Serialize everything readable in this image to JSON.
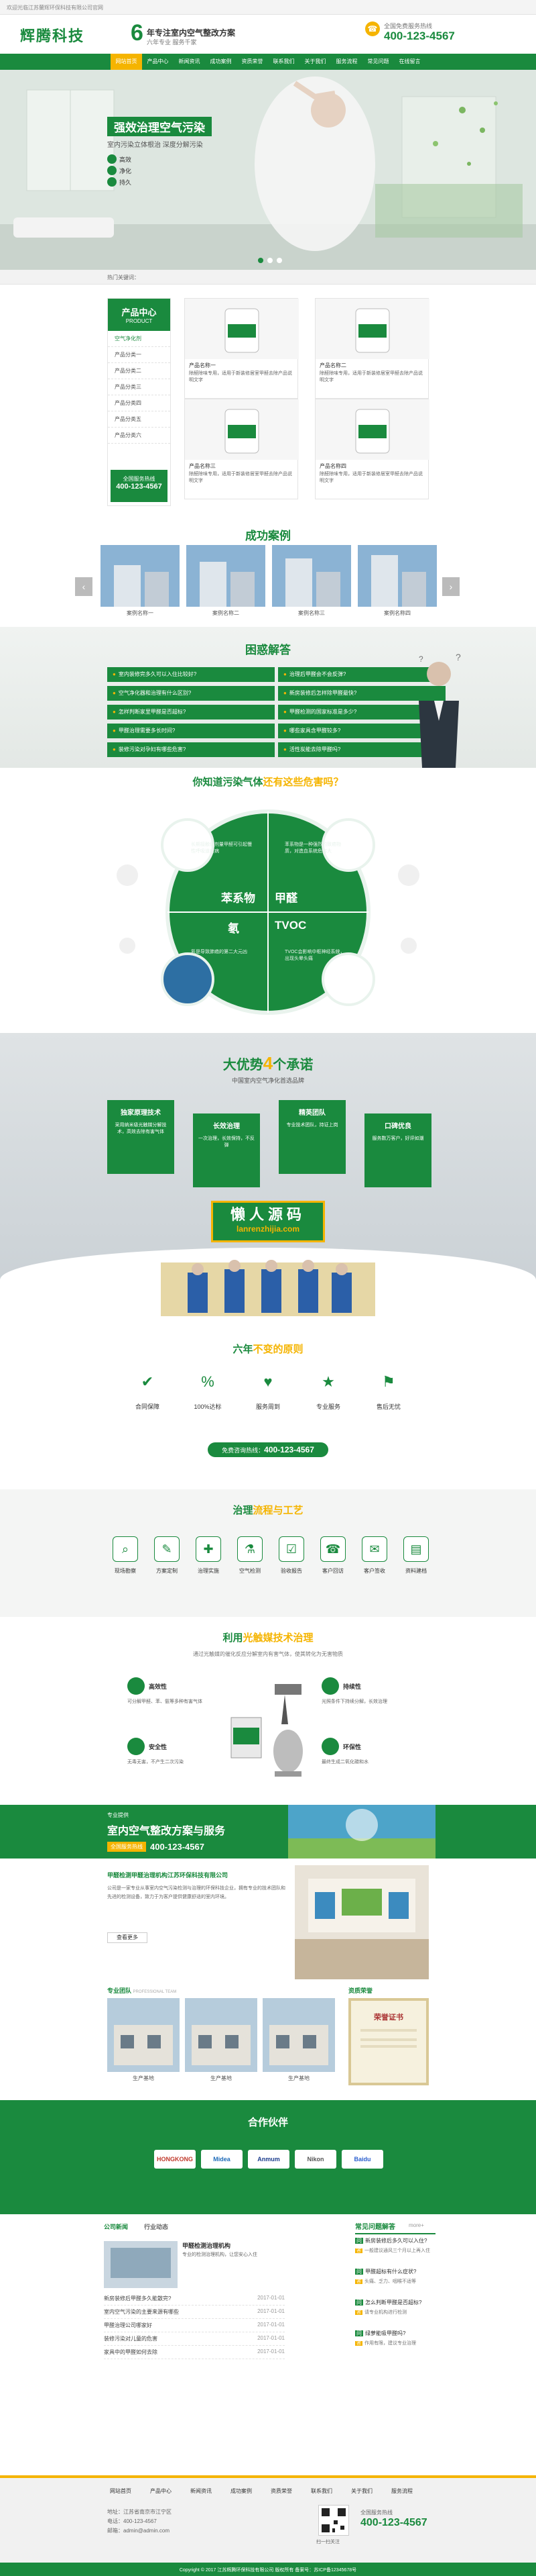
{
  "topbar": {
    "text": "欢迎光临江苏蘭辉环保科技有限公司官网"
  },
  "header": {
    "logo": "辉腾科技",
    "slogan_num": "6",
    "slogan_title": "年专注室内空气整改方案",
    "slogan_sub": "六年专业 服务千家",
    "hotline_label": "全国免费服务热线",
    "hotline": "400-123-4567"
  },
  "nav": [
    "网站首页",
    "产品中心",
    "新闻资讯",
    "成功案例",
    "资质荣誉",
    "联系我们",
    "关于我们",
    "服务流程",
    "常见问题",
    "在线留言"
  ],
  "nav_active": 0,
  "hero": {
    "title": "强效治理空气污染",
    "subtitle": "室内污染立体根治 深度分解污染",
    "features": [
      "高效",
      "净化",
      "持久"
    ],
    "dots": 3
  },
  "breadcrumb": "热门关键词：",
  "products": {
    "title": "产品中心",
    "title_en": "PRODUCT",
    "categories": [
      "空气净化剂",
      "产品分类一",
      "产品分类二",
      "产品分类三",
      "产品分类四",
      "产品分类五",
      "产品分类六"
    ],
    "hotline_label": "全国服务热线",
    "hotline": "400-123-4567",
    "items": [
      {
        "name": "产品名称一",
        "desc": "除醛除味专用，适用于新装修居室甲醛去除产品说明文字"
      },
      {
        "name": "产品名称二",
        "desc": "除醛除味专用，适用于新装修居室甲醛去除产品说明文字"
      },
      {
        "name": "产品名称三",
        "desc": "除醛除味专用，适用于新装修居室甲醛去除产品说明文字"
      },
      {
        "name": "产品名称四",
        "desc": "除醛除味专用，适用于新装修居室甲醛去除产品说明文字"
      }
    ]
  },
  "cases": {
    "title": "成功案例",
    "items": [
      "案例名称一",
      "案例名称二",
      "案例名称三",
      "案例名称四"
    ]
  },
  "faq": {
    "title": "困惑解答",
    "left": [
      "室内装修完多久可以入住比较好?",
      "空气净化器和治理有什么区别?",
      "怎样判断家里甲醛是否超标?",
      "甲醛治理需要多长时间?",
      "装修污染对孕妇有哪些危害?"
    ],
    "right": [
      "治理后甲醛会不会反弹?",
      "新房装修后怎样除甲醛最快?",
      "甲醛检测的国家标准是多少?",
      "哪些家具含甲醛较多?",
      "活性炭能去除甲醛吗?"
    ]
  },
  "pollution": {
    "title_a": "你知道污染气体",
    "title_b": "还有这些危害吗？",
    "center_words": [
      "苯系物",
      "甲醛",
      "氡",
      "TVOC"
    ],
    "texts": [
      "长期接触低剂量甲醛可引起慢性呼吸道疾病",
      "苯系物是一种强烈的致癌物质，对造血系统危害大",
      "氡是导致肺癌的第二大元凶",
      "TVOC会影响中枢神经系统，出现头晕头痛"
    ]
  },
  "advantage": {
    "title_a": "大优势",
    "num": "4",
    "title_b": "个承诺",
    "sub": "中国室内空气净化首选品牌",
    "boxes": [
      {
        "title": "独家原理技术",
        "text": "采用纳米级光触媒分解技术，高效去除有害气体"
      },
      {
        "title": "长效治理",
        "text": "一次治理，长效保持，不反弹"
      },
      {
        "title": "精英团队",
        "text": "专业技术团队，持证上岗"
      },
      {
        "title": "口碑优良",
        "text": "服务数万客户，好评如潮"
      }
    ],
    "watermark_cn": "懒人源码",
    "watermark_en": "lanrenzhijia.com"
  },
  "principle": {
    "title_a": "六年",
    "title_b": "不变的原则",
    "items": [
      "合同保障",
      "100%达标",
      "服务周到",
      "专业服务",
      "售后无忧"
    ],
    "btn_label": "免费咨询热线：",
    "hotline": "400-123-4567"
  },
  "process": {
    "title_a": "治理",
    "title_b": "流程与工艺",
    "steps": [
      "现场勘察",
      "方案定制",
      "治理实施",
      "空气检测",
      "验收报告",
      "客户回访",
      "客户签收",
      "资料建档"
    ]
  },
  "tech": {
    "title_a": "利用",
    "title_b": "光触媒技术治理",
    "intro": "通过光触媒的催化反应分解室内有害气体，使其转化为无害物质",
    "left": [
      {
        "title": "高效性",
        "text": "可分解甲醛、苯、氨等多种有害气体"
      },
      {
        "title": "安全性",
        "text": "无毒无害，不产生二次污染"
      }
    ],
    "right": [
      {
        "title": "持续性",
        "text": "光照条件下持续分解，长效治理"
      },
      {
        "title": "环保性",
        "text": "最终生成二氧化碳和水"
      }
    ]
  },
  "banner": {
    "small": "专业提供",
    "title": "室内空气整改方案与服务",
    "hotline_label": "全国服务热线",
    "hotline": "400-123-4567"
  },
  "about": {
    "title": "甲醛检测甲醛治理机构江苏环保科技有限公司",
    "text": "公司是一家专业从事室内空气污染检测与治理的环保科技企业，拥有专业的技术团队和先进的检测设备，致力于为客户提供健康舒适的室内环境。",
    "more": "查看更多"
  },
  "team": {
    "label": "专业团队",
    "sub": "PROFESSIONAL TEAM",
    "items": [
      "生产基地",
      "生产基地",
      "生产基地"
    ],
    "honor_label": "资质荣誉",
    "honor_name": "荣誉证书"
  },
  "partners": {
    "title": "合作伙伴",
    "logos": [
      "HONGKONG",
      "Midea",
      "Anmum",
      "Nikon",
      "Baidu"
    ]
  },
  "news": {
    "tabs": [
      "公司新闻",
      "行业动态"
    ],
    "featured_title": "甲醛检测治理机构",
    "featured_text": "专业的检测治理机构，让您安心入住",
    "list": [
      {
        "title": "新房装修后甲醛多久能散完?",
        "date": "2017-01-01"
      },
      {
        "title": "室内空气污染的主要来源有哪些",
        "date": "2017-01-01"
      },
      {
        "title": "甲醛治理公司哪家好",
        "date": "2017-01-01"
      },
      {
        "title": "装修污染对儿童的危害",
        "date": "2017-01-01"
      },
      {
        "title": "家具中的甲醛如何去除",
        "date": "2017-01-01"
      }
    ]
  },
  "qa": {
    "title": "常见问题解答",
    "more": "more+",
    "items": [
      {
        "q": "新房装修后多久可以入住?",
        "a": "一般建议通风三个月以上再入住"
      },
      {
        "q": "甲醛超标有什么症状?",
        "a": "头痛、乏力、咽喉不适等"
      },
      {
        "q": "怎么判断甲醛是否超标?",
        "a": "请专业机构进行检测"
      },
      {
        "q": "绿萝能吸甲醛吗?",
        "a": "作用有限，建议专业治理"
      }
    ]
  },
  "footer": {
    "links": [
      "网站首页",
      "产品中心",
      "新闻资讯",
      "成功案例",
      "资质荣誉",
      "联系我们",
      "关于我们",
      "服务流程"
    ],
    "contact": [
      "地址：江苏省南京市江宁区",
      "电话：400-123-4567",
      "邮箱：admin@admin.com"
    ],
    "qrcode_label": "扫一扫关注",
    "hotline_label": "全国服务热线",
    "hotline": "400-123-4567",
    "copyright": "Copyright © 2017 江苏辉腾环保科技有限公司 版权所有  备案号：苏ICP备12345678号"
  },
  "colors": {
    "green": "#1a8a3e",
    "yellow": "#f5b400"
  }
}
